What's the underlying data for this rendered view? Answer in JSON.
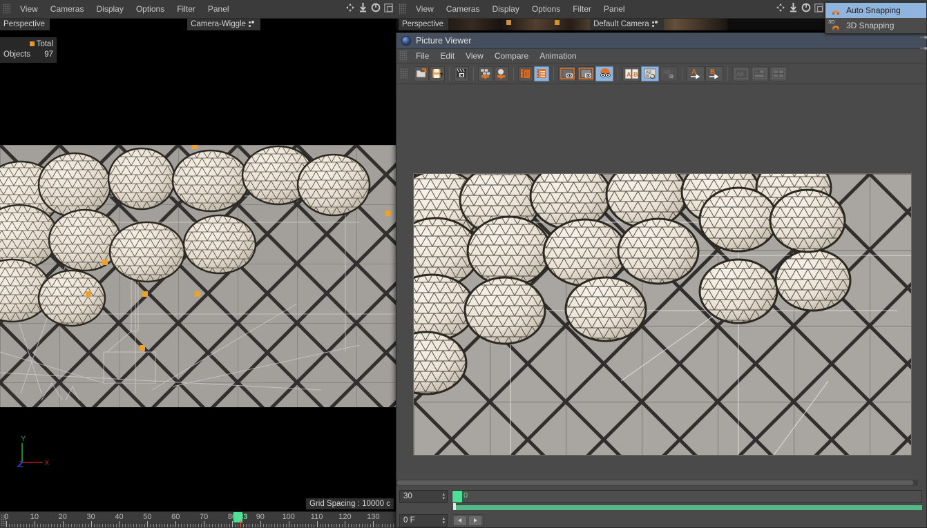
{
  "left_viewport": {
    "menus": [
      "View",
      "Cameras",
      "Display",
      "Options",
      "Filter",
      "Panel"
    ],
    "projection_label": "Perspective",
    "camera_label": "Camera-Wiggle",
    "stats": {
      "header": "Total",
      "row_label": "Objects",
      "row_value": "97"
    },
    "grid_spacing": "Grid Spacing : 10000 c",
    "axis": {
      "x": "X",
      "y": "Y",
      "z": "Z",
      "x_color": "#b42020",
      "y_color": "#1faa1f",
      "z_color": "#2a3fd0"
    },
    "icons": [
      "move-icon",
      "zoom-icon",
      "rotate-icon",
      "maximize-icon"
    ]
  },
  "right_viewport": {
    "menus": [
      "View",
      "Cameras",
      "Display",
      "Options",
      "Filter",
      "Panel"
    ],
    "projection_label": "Perspective",
    "camera_label": "Default Camera",
    "icons": [
      "move-icon",
      "zoom-icon",
      "rotate-icon",
      "maximize-icon"
    ]
  },
  "snap_menu": {
    "items": [
      {
        "label": "Auto Snapping",
        "selected": true,
        "sup": ""
      },
      {
        "label": "3D Snapping",
        "selected": false,
        "sup": "3D"
      }
    ],
    "highlight_color": "#8fb4dd"
  },
  "picture_viewer": {
    "title": "Picture Viewer",
    "menus": [
      "File",
      "Edit",
      "View",
      "Compare",
      "Animation"
    ],
    "toolbar": [
      {
        "name": "open-image-button",
        "glyph": "folder",
        "state": "normal"
      },
      {
        "name": "save-image-as-button",
        "glyph": "save-question",
        "state": "normal"
      },
      {
        "name": "clear-render-button",
        "glyph": "clapboard-x",
        "state": "normal"
      },
      {
        "name": "send-to-filmstrip-button",
        "glyph": "filmstrip-down",
        "state": "normal"
      },
      {
        "name": "send-to-object-button",
        "glyph": "sphere-down",
        "state": "normal"
      },
      {
        "name": "delete-entry-button",
        "glyph": "trash",
        "state": "normal"
      },
      {
        "name": "history-button",
        "glyph": "notebook",
        "state": "active"
      },
      {
        "name": "preview-a-button",
        "glyph": "eye-frame-a",
        "state": "normal"
      },
      {
        "name": "preview-b-button",
        "glyph": "eye-frame-b",
        "state": "normal"
      },
      {
        "name": "preview-both-button",
        "glyph": "eye-face",
        "state": "active"
      },
      {
        "name": "compare-ab-button",
        "glyph": "ab-split",
        "state": "normal"
      },
      {
        "name": "compare-overlay-button",
        "glyph": "ab-overlay",
        "state": "active"
      },
      {
        "name": "compare-diff-button",
        "glyph": "ab-diff",
        "state": "disabled"
      },
      {
        "name": "set-a-button",
        "glyph": "a-arrow",
        "state": "normal"
      },
      {
        "name": "set-b-button",
        "glyph": "b-arrow",
        "state": "normal"
      },
      {
        "name": "layout-side-button",
        "glyph": "layout-side",
        "state": "disabled"
      },
      {
        "name": "layout-stack-button",
        "glyph": "layout-stack",
        "state": "disabled"
      },
      {
        "name": "layout-grid-button",
        "glyph": "layout-grid",
        "state": "disabled"
      }
    ],
    "footer": {
      "fps_value": "30",
      "frame_value": "0 F",
      "timebar_label": "0",
      "prev_frame": "◀",
      "next_frame": "▶"
    }
  },
  "timeline": {
    "labels": [
      "0",
      "10",
      "20",
      "30",
      "40",
      "50",
      "60",
      "70",
      "80",
      "90",
      "100",
      "110",
      "120",
      "130"
    ],
    "current_frame": "83",
    "current_frame_color": "#4ede95",
    "min": 0,
    "max": 138
  }
}
